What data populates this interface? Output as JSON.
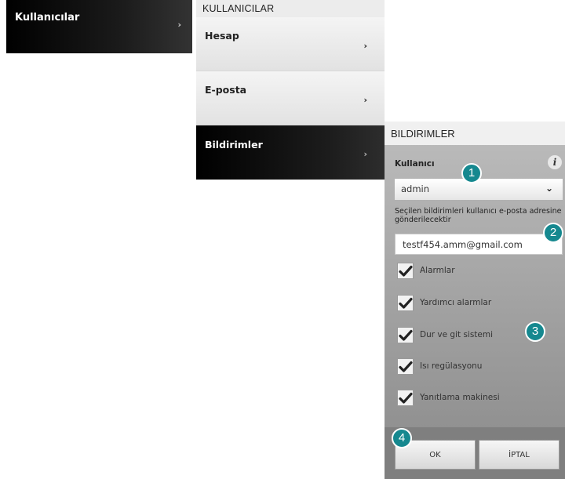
{
  "left_menu": {
    "label": "Kullanıcılar",
    "chevron": "›"
  },
  "users_panel": {
    "title": "KULLANICILAR",
    "items": [
      {
        "label": "Hesap",
        "chevron": "›"
      },
      {
        "label": "E-posta",
        "chevron": "›"
      },
      {
        "label": "Bildirimler",
        "chevron": "›",
        "selected": true
      }
    ]
  },
  "notifications": {
    "title": "BILDIRIMLER",
    "user_label": "Kullanıcı",
    "info_icon": "i",
    "user_select": {
      "value": "admin",
      "caret": "⌄"
    },
    "helper_text": "Seçilen bildirimleri kullanıcı e-posta adresine gönderilecektir",
    "email_value": "testf454.amm@gmail.com",
    "options": [
      {
        "label": "Alarmlar",
        "checked": true
      },
      {
        "label": "Yardımcı alarmlar",
        "checked": true
      },
      {
        "label": "Dur ve git sistemi",
        "checked": true
      },
      {
        "label": "Isı regülasyonu",
        "checked": true
      },
      {
        "label": "Yanıtlama makinesi",
        "checked": true
      }
    ],
    "ok_label": "OK",
    "cancel_label": "İPTAL"
  },
  "callouts": [
    "1",
    "2",
    "3",
    "4"
  ],
  "colors": {
    "callout": "#15888f",
    "selected_bg": "#000000",
    "panel_bg": "#a8a8a8"
  }
}
